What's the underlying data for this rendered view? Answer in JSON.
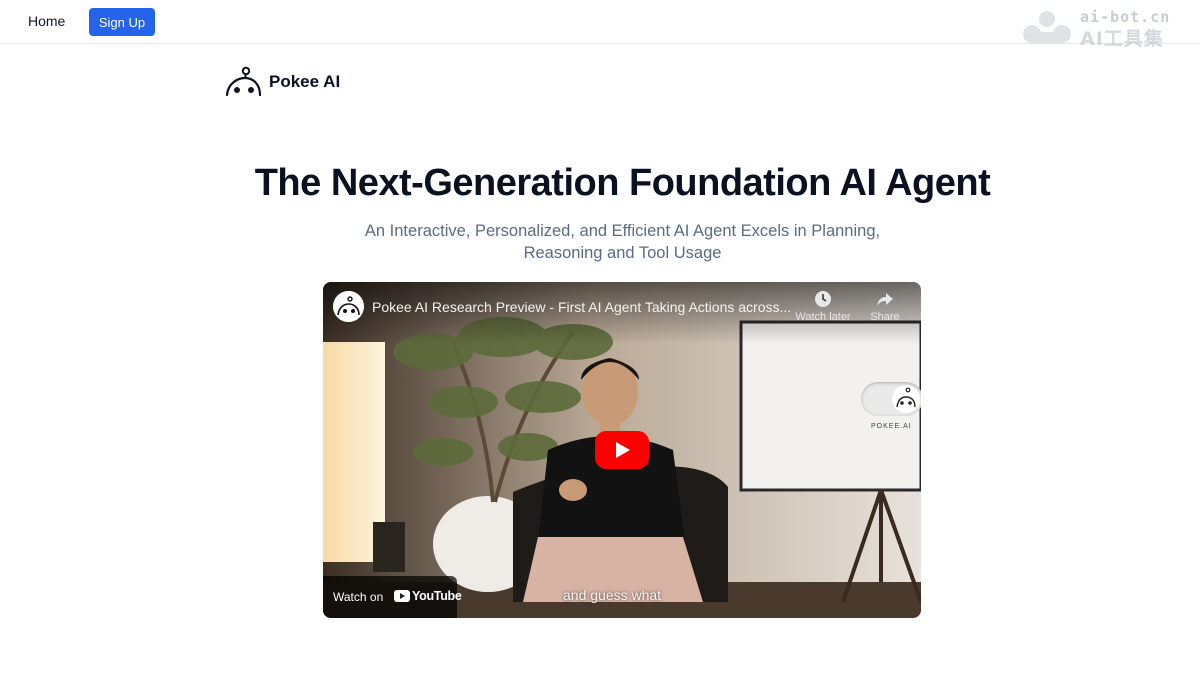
{
  "nav": {
    "home_label": "Home",
    "signup_label": "Sign Up"
  },
  "watermark": {
    "line1": "ai-bot.cn",
    "line2": "AI工具集"
  },
  "brand": {
    "name": "Pokee AI"
  },
  "hero": {
    "headline": "The Next-Generation Foundation AI Agent",
    "subtitle": "An Interactive, Personalized, and Efficient AI Agent Excels in Planning, Reasoning and Tool Usage"
  },
  "video": {
    "title": "Pokee AI Research Preview - First AI Agent Taking Actions across...",
    "watch_later_label": "Watch later",
    "share_label": "Share",
    "watch_on_label": "Watch on",
    "youtube_label": "YouTube",
    "caption": "and guess what",
    "screen_text": "POKEE.AI"
  },
  "colors": {
    "primary_button": "#2563eb",
    "play_button": "#ff0000",
    "subtitle_text": "#5b6b82"
  },
  "icons": [
    "pokee-logo-icon",
    "watch-later-clock-icon",
    "share-arrow-icon",
    "play-icon",
    "youtube-logo-icon",
    "watermark-icon"
  ]
}
